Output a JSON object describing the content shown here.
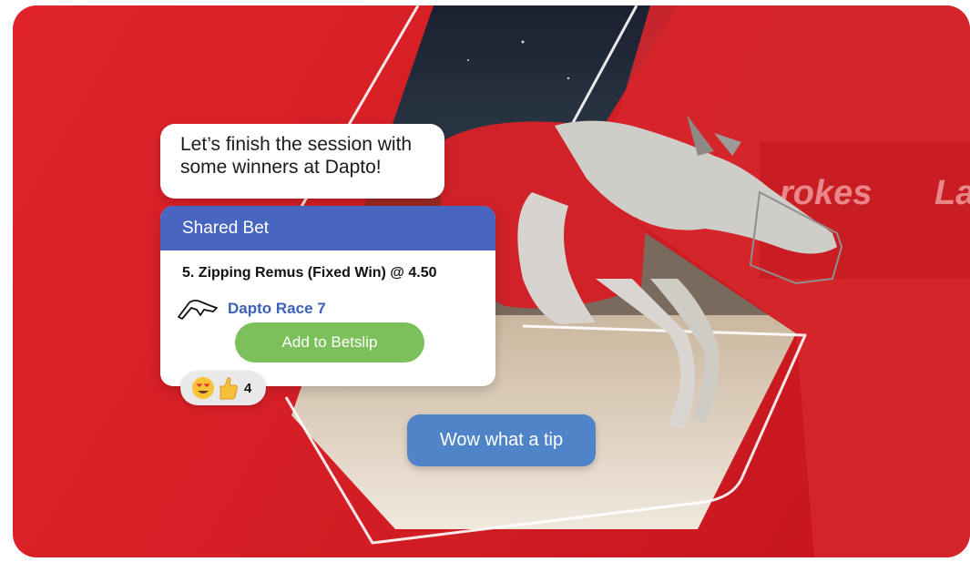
{
  "colors": {
    "background_red": "#d41e25",
    "header_blue": "#4866c0",
    "race_link_blue": "#3d60b8",
    "button_green": "#7cc05c",
    "reply_blue": "#4f84c8"
  },
  "chat": {
    "message_top_line1": "Let’s finish the session with",
    "message_top_line2": "some winners at Dapto!",
    "reply_message": "Wow what a tip"
  },
  "bet_card": {
    "header": "Shared Bet",
    "selection": "5. Zipping Remus (Fixed Win) @ 4.50",
    "race_icon": "greyhound-icon",
    "race_label": "Dapto Race 7",
    "add_button_label": "Add to Betslip"
  },
  "reactions": {
    "icons": [
      "heart-eyes-emoji-icon",
      "thumbs-up-emoji-icon"
    ],
    "count": "4"
  },
  "background": {
    "banner_text": "rokes",
    "banner_text_right": "La"
  }
}
